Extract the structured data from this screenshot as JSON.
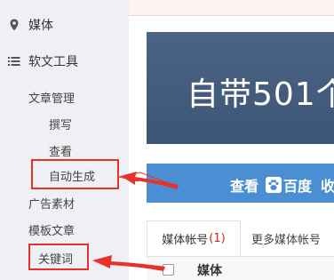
{
  "sidebar": {
    "items": [
      {
        "label": "媒体",
        "icon": "map-pin-icon"
      },
      {
        "label": "软文工具",
        "icon": "list-icon"
      }
    ],
    "group_label": "文章管理",
    "sub_items": [
      "撰写",
      "查看",
      "自动生成"
    ],
    "items2": [
      "广告素材",
      "模板文章",
      "关键词"
    ]
  },
  "main": {
    "banner_text": "自带501个",
    "bluebar": {
      "prefix": "查看",
      "baidu": "百度",
      "suffix": "收"
    },
    "tabs": [
      {
        "label": "媒体帐号",
        "count": "(1)"
      },
      {
        "label": "更多媒体帐号"
      }
    ],
    "table": {
      "col1": "媒体"
    }
  },
  "colors": {
    "accent_red": "#e8312b",
    "banner_bg": "#4c6484",
    "bluebar_bg": "#4a8ed3",
    "sidebar_bg": "#eef0f3"
  }
}
